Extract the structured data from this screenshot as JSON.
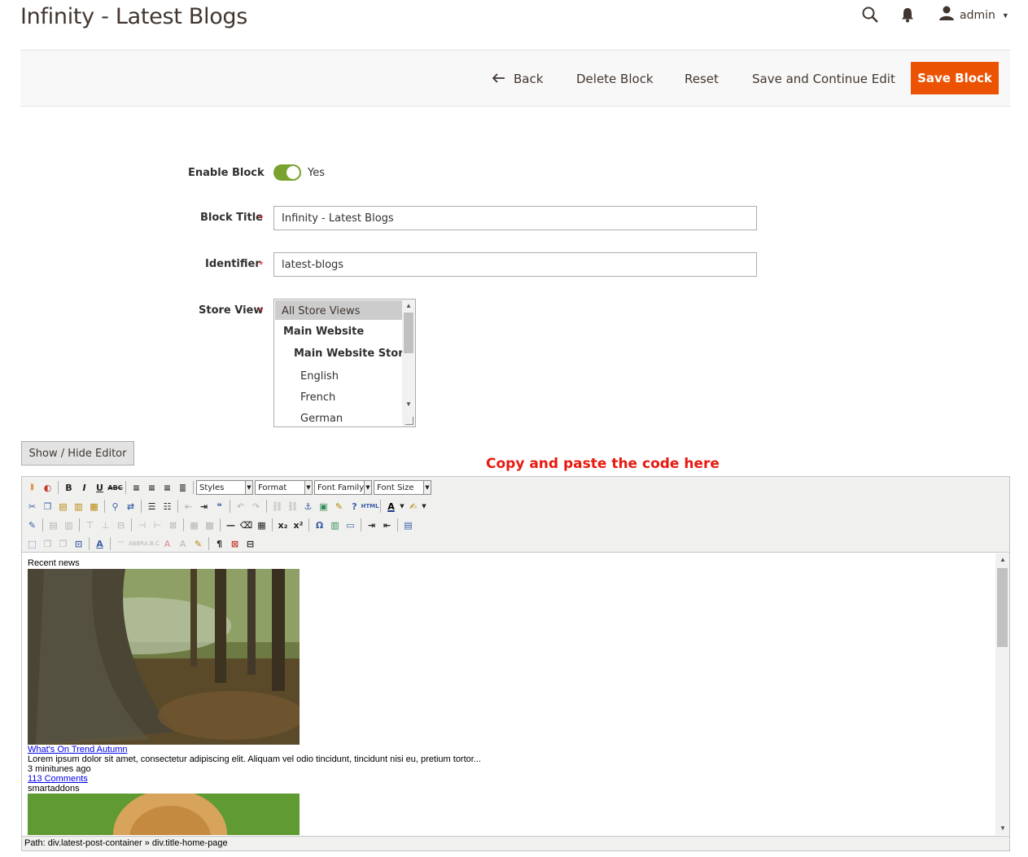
{
  "page": {
    "title": "Infinity - Latest Blogs"
  },
  "header": {
    "user_name": "admin"
  },
  "actions": {
    "back": "Back",
    "delete": "Delete Block",
    "reset": "Reset",
    "save_continue": "Save and Continue Edit",
    "save": "Save Block"
  },
  "form": {
    "enable": {
      "label": "Enable Block",
      "value_label": "Yes",
      "enabled": true
    },
    "title": {
      "label": "Block Title",
      "required_mark": "*",
      "value": "Infinity - Latest Blogs"
    },
    "identifier": {
      "label": "Identifier",
      "required_mark": "*",
      "value": "latest-blogs"
    },
    "store_view": {
      "label": "Store View",
      "required_mark": "*",
      "options": [
        "All Store Views",
        "Main Website",
        "Main Website Store",
        "English",
        "French",
        "German"
      ],
      "selected": "All Store Views"
    }
  },
  "editor": {
    "toggle_label": "Show / Hide Editor",
    "annotation": "Copy and paste the code here",
    "selects": [
      "Styles",
      "Format",
      "Font Family",
      "Font Size"
    ],
    "content": {
      "heading": "Recent news",
      "post1_title": "What's On Trend Autumn",
      "post1_excerpt": "Lorem ipsum dolor sit amet, consectetur adipiscing elit. Aliquam vel odio tincidunt, tincidunt nisi eu, pretium tortor...",
      "post1_time": "3 minitunes ago",
      "post1_comments": "113 Comments",
      "post1_author": "smartaddons"
    },
    "path": "Path: div.latest-post-container » div.title-home-page"
  },
  "colors": {
    "primary": "#eb5202",
    "toggle_on": "#79a22e",
    "annotation": "#e8190f",
    "link": "#0000ee"
  }
}
